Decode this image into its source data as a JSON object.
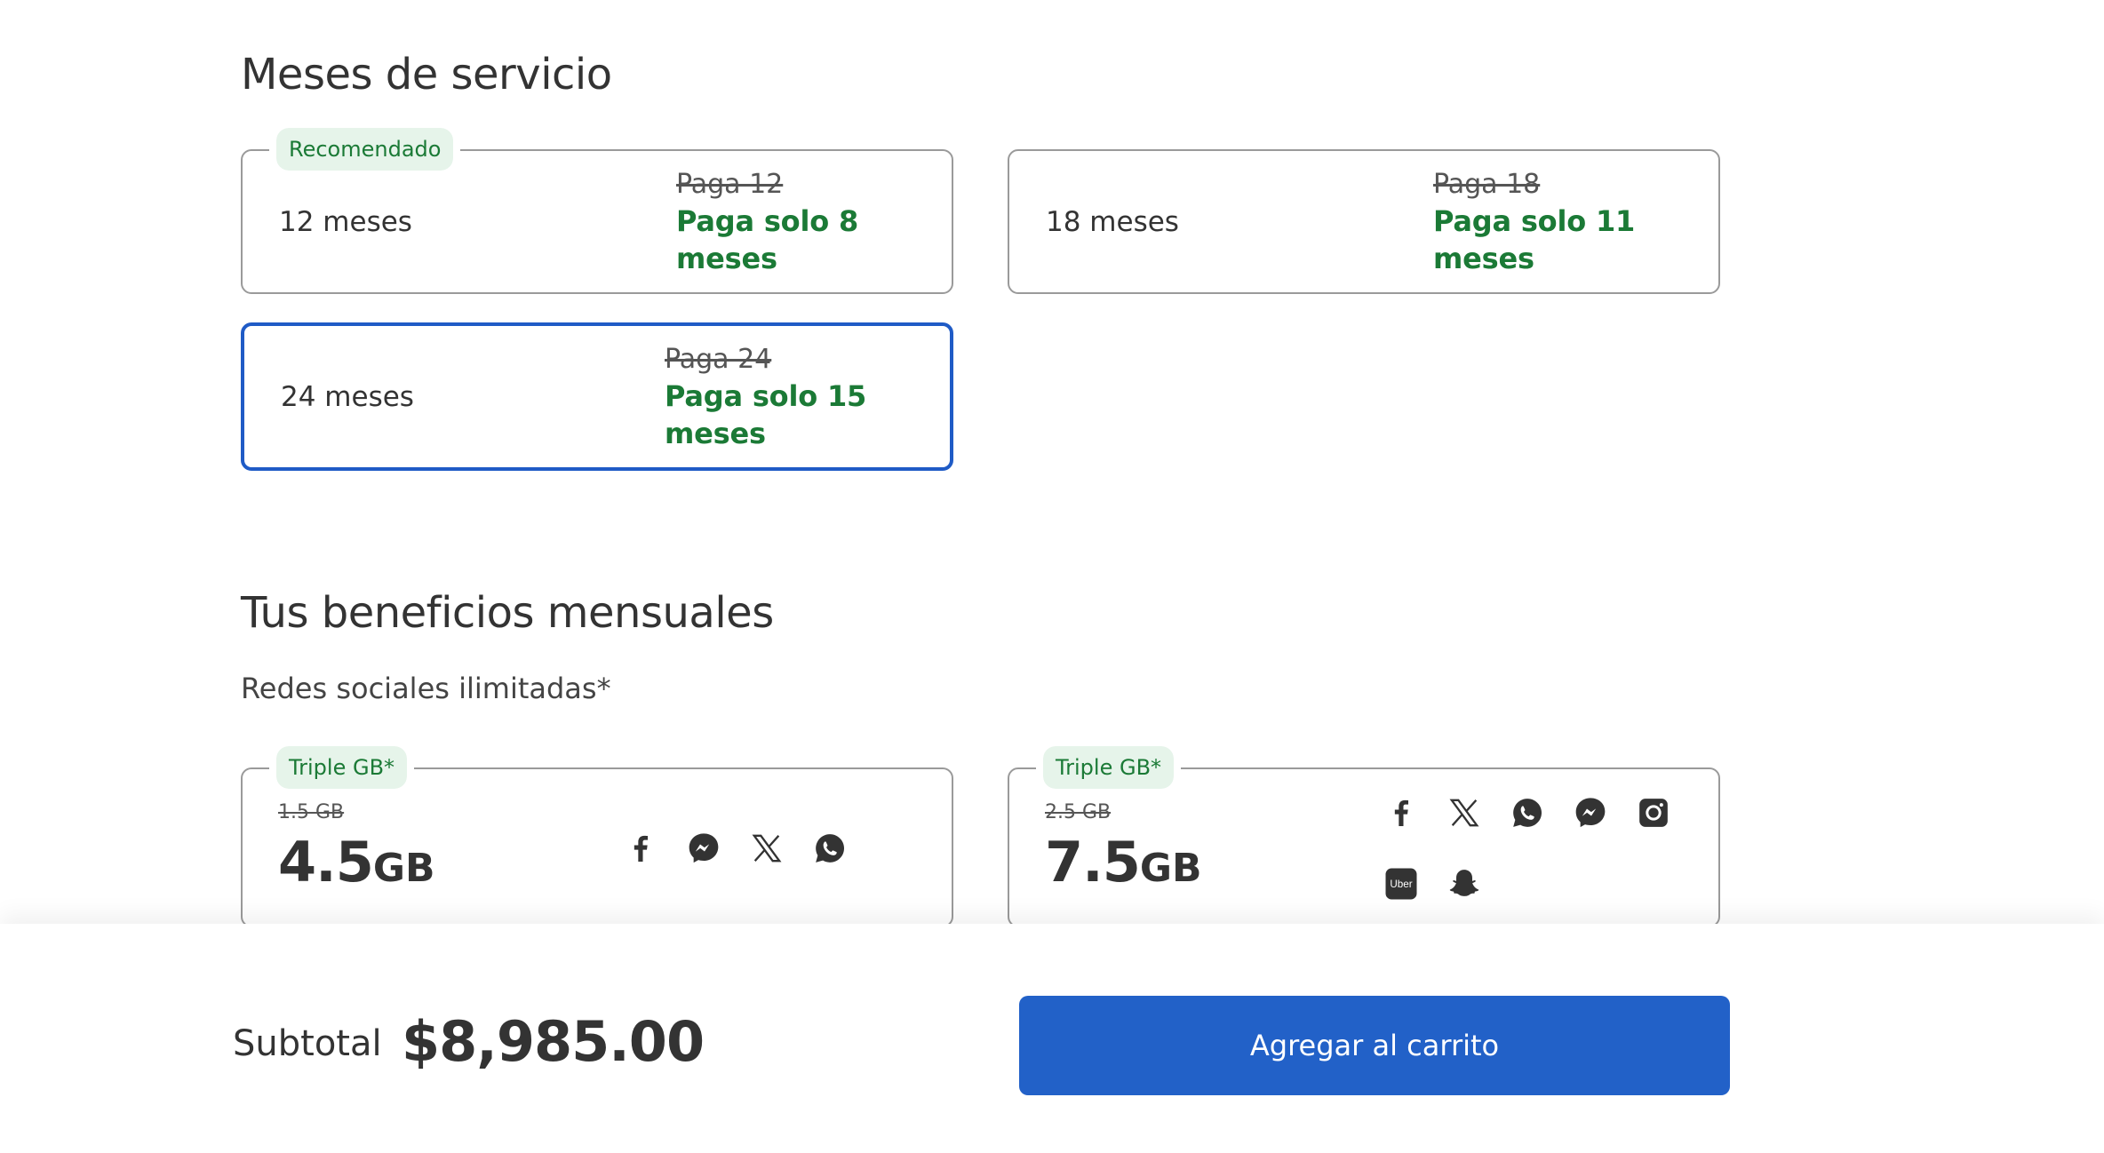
{
  "service_months": {
    "title": "Meses de servicio",
    "options": [
      {
        "badge": "Recomendado",
        "months": "12 meses",
        "old_price": "Paga 12",
        "offer": "Paga solo 8 meses",
        "selected": false
      },
      {
        "badge": "",
        "months": "18 meses",
        "old_price": "Paga 18",
        "offer": "Paga solo 11 meses",
        "selected": false
      },
      {
        "badge": "",
        "months": "24 meses",
        "old_price": "Paga 24",
        "offer": "Paga solo 15 meses",
        "selected": true
      }
    ]
  },
  "benefits": {
    "title": "Tus beneficios mensuales",
    "subtitle": "Redes sociales ilimitadas*",
    "plans": [
      {
        "badge": "Triple GB*",
        "old_gb": "1.5 GB",
        "gb_value": "4.5",
        "gb_unit": "GB",
        "icons": [
          "facebook-icon",
          "messenger-icon",
          "x-icon",
          "whatsapp-icon"
        ]
      },
      {
        "badge": "Triple GB*",
        "old_gb": "2.5 GB",
        "gb_value": "7.5",
        "gb_unit": "GB",
        "icons": [
          "facebook-icon",
          "x-icon",
          "whatsapp-icon",
          "messenger-icon",
          "instagram-icon",
          "uber-icon",
          "snapchat-icon"
        ],
        "uber_text": "Uber"
      }
    ]
  },
  "footer": {
    "subtotal_label": "Subtotal",
    "subtotal_value": "$8,985.00",
    "cart_button": "Agregar al carrito"
  },
  "colors": {
    "accent_blue": "#2261c8",
    "selected_border": "#1f5bc6",
    "offer_green": "#1b7a36",
    "badge_bg": "#e6f4ea",
    "text": "#333333"
  }
}
